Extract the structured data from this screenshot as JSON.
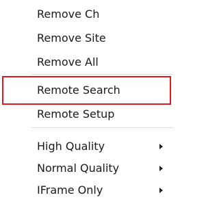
{
  "menu": {
    "items": [
      {
        "label": "Remove Ch"
      },
      {
        "label": "Remove Site"
      },
      {
        "label": "Remove All"
      },
      {
        "label": "Remote Search"
      },
      {
        "label": "Remote Setup"
      },
      {
        "label": "High Quality"
      },
      {
        "label": "Normal Quality"
      },
      {
        "label": "IFrame Only"
      }
    ]
  },
  "colors": {
    "highlight_border": "#e8141e",
    "menu_background": "#ffffff",
    "text": "#1a1a1a"
  }
}
